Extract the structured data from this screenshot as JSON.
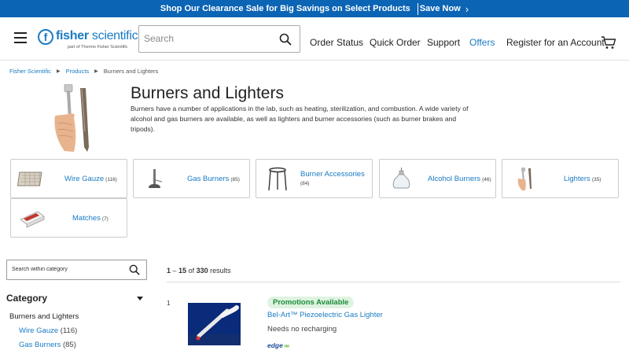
{
  "promo": {
    "text": "Shop Our Clearance Sale for Big Savings on Select Products",
    "link": "Save Now"
  },
  "header": {
    "logo": {
      "name_bold": "fisher",
      "name_rest": " scientific",
      "tagline": "part of Thermo Fisher Scientific"
    },
    "search_placeholder": "Search",
    "nav": [
      "Order Status",
      "Quick Order",
      "Support",
      "Offers",
      "Register for an Account"
    ]
  },
  "breadcrumb": [
    "Fisher Scientific",
    "Products",
    "Burners and Lighters"
  ],
  "page": {
    "title": "Burners and Lighters",
    "description": "Burners have a number of applications in the lab, such as heating, sterilization, and combustion. A wide variety of alcohol and gas burners are available, as well as lighters and burner accessories (such as burner brakes and tripods)."
  },
  "tiles": [
    {
      "label": "Wire Gauze",
      "count": "(116)",
      "icon": "wire-gauze-icon"
    },
    {
      "label": "Gas Burners",
      "count": "(85)",
      "icon": "gas-burner-icon"
    },
    {
      "label": "Burner Accessories",
      "count": "(84)",
      "icon": "tripod-icon"
    },
    {
      "label": "Alcohol Burners",
      "count": "(46)",
      "icon": "alcohol-burner-icon"
    },
    {
      "label": "Lighters",
      "count": "(35)",
      "icon": "lighter-icon"
    },
    {
      "label": "Matches",
      "count": "(7)",
      "icon": "matches-icon"
    }
  ],
  "sidebar": {
    "search_placeholder": "Search within category",
    "category_heading": "Category",
    "root": "Burners and Lighters",
    "items": [
      {
        "label": "Wire Gauze",
        "count": "(116)"
      },
      {
        "label": "Gas Burners",
        "count": "(85)"
      }
    ]
  },
  "results": {
    "range_start": "1",
    "range_end": "15",
    "of": "of",
    "total": "330",
    "suffix": "results",
    "items": [
      {
        "index": "1",
        "badge": "Promotions Available",
        "title": "Bel-Art™ Piezoelectric Gas Lighter",
        "subtitle": "Needs no recharging",
        "brand": "edge"
      }
    ]
  },
  "colors": {
    "brand_blue": "#0b64b4",
    "link_blue": "#1a7bc4",
    "promo_green": "#1b8c3a"
  }
}
